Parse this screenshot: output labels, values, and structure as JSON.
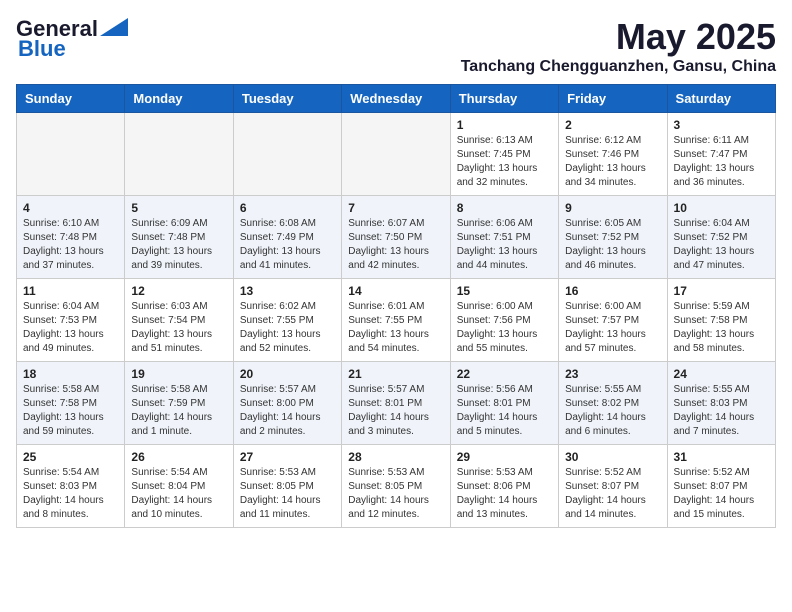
{
  "header": {
    "logo_line1": "General",
    "logo_line2": "Blue",
    "title": "May 2025",
    "subtitle": "Tanchang Chengguanzhen, Gansu, China"
  },
  "calendar": {
    "days_of_week": [
      "Sunday",
      "Monday",
      "Tuesday",
      "Wednesday",
      "Thursday",
      "Friday",
      "Saturday"
    ],
    "rows": [
      [
        {
          "day": "",
          "info": ""
        },
        {
          "day": "",
          "info": ""
        },
        {
          "day": "",
          "info": ""
        },
        {
          "day": "",
          "info": ""
        },
        {
          "day": "1",
          "info": "Sunrise: 6:13 AM\nSunset: 7:45 PM\nDaylight: 13 hours\nand 32 minutes."
        },
        {
          "day": "2",
          "info": "Sunrise: 6:12 AM\nSunset: 7:46 PM\nDaylight: 13 hours\nand 34 minutes."
        },
        {
          "day": "3",
          "info": "Sunrise: 6:11 AM\nSunset: 7:47 PM\nDaylight: 13 hours\nand 36 minutes."
        }
      ],
      [
        {
          "day": "4",
          "info": "Sunrise: 6:10 AM\nSunset: 7:48 PM\nDaylight: 13 hours\nand 37 minutes."
        },
        {
          "day": "5",
          "info": "Sunrise: 6:09 AM\nSunset: 7:48 PM\nDaylight: 13 hours\nand 39 minutes."
        },
        {
          "day": "6",
          "info": "Sunrise: 6:08 AM\nSunset: 7:49 PM\nDaylight: 13 hours\nand 41 minutes."
        },
        {
          "day": "7",
          "info": "Sunrise: 6:07 AM\nSunset: 7:50 PM\nDaylight: 13 hours\nand 42 minutes."
        },
        {
          "day": "8",
          "info": "Sunrise: 6:06 AM\nSunset: 7:51 PM\nDaylight: 13 hours\nand 44 minutes."
        },
        {
          "day": "9",
          "info": "Sunrise: 6:05 AM\nSunset: 7:52 PM\nDaylight: 13 hours\nand 46 minutes."
        },
        {
          "day": "10",
          "info": "Sunrise: 6:04 AM\nSunset: 7:52 PM\nDaylight: 13 hours\nand 47 minutes."
        }
      ],
      [
        {
          "day": "11",
          "info": "Sunrise: 6:04 AM\nSunset: 7:53 PM\nDaylight: 13 hours\nand 49 minutes."
        },
        {
          "day": "12",
          "info": "Sunrise: 6:03 AM\nSunset: 7:54 PM\nDaylight: 13 hours\nand 51 minutes."
        },
        {
          "day": "13",
          "info": "Sunrise: 6:02 AM\nSunset: 7:55 PM\nDaylight: 13 hours\nand 52 minutes."
        },
        {
          "day": "14",
          "info": "Sunrise: 6:01 AM\nSunset: 7:55 PM\nDaylight: 13 hours\nand 54 minutes."
        },
        {
          "day": "15",
          "info": "Sunrise: 6:00 AM\nSunset: 7:56 PM\nDaylight: 13 hours\nand 55 minutes."
        },
        {
          "day": "16",
          "info": "Sunrise: 6:00 AM\nSunset: 7:57 PM\nDaylight: 13 hours\nand 57 minutes."
        },
        {
          "day": "17",
          "info": "Sunrise: 5:59 AM\nSunset: 7:58 PM\nDaylight: 13 hours\nand 58 minutes."
        }
      ],
      [
        {
          "day": "18",
          "info": "Sunrise: 5:58 AM\nSunset: 7:58 PM\nDaylight: 13 hours\nand 59 minutes."
        },
        {
          "day": "19",
          "info": "Sunrise: 5:58 AM\nSunset: 7:59 PM\nDaylight: 14 hours\nand 1 minute."
        },
        {
          "day": "20",
          "info": "Sunrise: 5:57 AM\nSunset: 8:00 PM\nDaylight: 14 hours\nand 2 minutes."
        },
        {
          "day": "21",
          "info": "Sunrise: 5:57 AM\nSunset: 8:01 PM\nDaylight: 14 hours\nand 3 minutes."
        },
        {
          "day": "22",
          "info": "Sunrise: 5:56 AM\nSunset: 8:01 PM\nDaylight: 14 hours\nand 5 minutes."
        },
        {
          "day": "23",
          "info": "Sunrise: 5:55 AM\nSunset: 8:02 PM\nDaylight: 14 hours\nand 6 minutes."
        },
        {
          "day": "24",
          "info": "Sunrise: 5:55 AM\nSunset: 8:03 PM\nDaylight: 14 hours\nand 7 minutes."
        }
      ],
      [
        {
          "day": "25",
          "info": "Sunrise: 5:54 AM\nSunset: 8:03 PM\nDaylight: 14 hours\nand 8 minutes."
        },
        {
          "day": "26",
          "info": "Sunrise: 5:54 AM\nSunset: 8:04 PM\nDaylight: 14 hours\nand 10 minutes."
        },
        {
          "day": "27",
          "info": "Sunrise: 5:53 AM\nSunset: 8:05 PM\nDaylight: 14 hours\nand 11 minutes."
        },
        {
          "day": "28",
          "info": "Sunrise: 5:53 AM\nSunset: 8:05 PM\nDaylight: 14 hours\nand 12 minutes."
        },
        {
          "day": "29",
          "info": "Sunrise: 5:53 AM\nSunset: 8:06 PM\nDaylight: 14 hours\nand 13 minutes."
        },
        {
          "day": "30",
          "info": "Sunrise: 5:52 AM\nSunset: 8:07 PM\nDaylight: 14 hours\nand 14 minutes."
        },
        {
          "day": "31",
          "info": "Sunrise: 5:52 AM\nSunset: 8:07 PM\nDaylight: 14 hours\nand 15 minutes."
        }
      ]
    ]
  }
}
